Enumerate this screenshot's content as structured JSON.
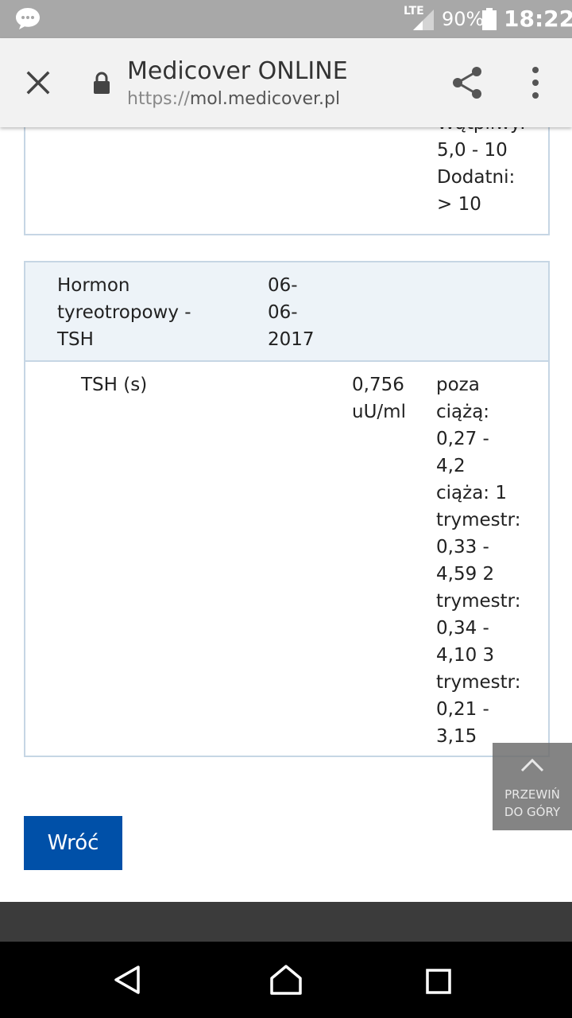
{
  "status_bar": {
    "network": "LTE",
    "battery": "90%",
    "time": "18:22"
  },
  "browser": {
    "title": "Medicover ONLINE",
    "url_scheme": "https://",
    "url_host": "mol.medicover.pl"
  },
  "previous_result": {
    "reference_lines": [
      "Wątpliwy:",
      "5,0 - 10",
      "Dodatni:",
      "> 10"
    ]
  },
  "test": {
    "name_lines": [
      "Hormon",
      "tyreotropowy -",
      "TSH"
    ],
    "date_lines": [
      "06-",
      "06-",
      "2017"
    ],
    "parameter": "TSH (s)",
    "value_lines": [
      "0,756",
      "uU/ml"
    ],
    "reference_lines": [
      "poza",
      "ciążą:",
      "0,27 -",
      "4,2",
      "ciąża: 1",
      "trymestr:",
      "0,33 -",
      "4,59 2",
      "trymestr:",
      "0,34 -",
      "4,10 3",
      "trymestr:",
      "0,21 -",
      "3,15"
    ]
  },
  "back_button": "Wróć",
  "scroll_top": [
    "PRZEWIŃ",
    "DO GÓRY"
  ],
  "colors": {
    "primary_button": "#0050a8",
    "card_border": "#c6d6e4",
    "card_header_bg": "#edf3f8"
  }
}
